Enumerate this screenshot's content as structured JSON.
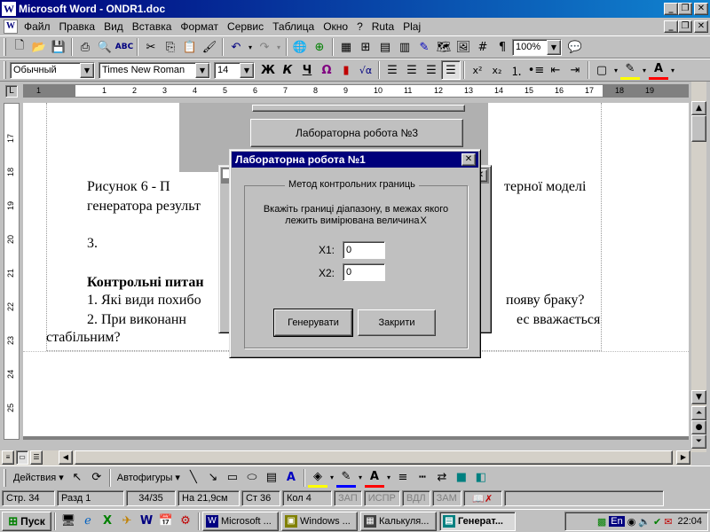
{
  "window": {
    "title": "Microsoft Word - ONDR1.doc",
    "app_icon": "W"
  },
  "menu": [
    "Файл",
    "Правка",
    "Вид",
    "Вставка",
    "Формат",
    "Сервис",
    "Таблица",
    "Окно",
    "?",
    "Ruta",
    "Plaj"
  ],
  "toolbar": {
    "zoom": "100%"
  },
  "format": {
    "style": "Обычный",
    "font": "Times New Roman",
    "size": "14",
    "bold": "Ж",
    "italic": "К",
    "underline": "Ч"
  },
  "ruler": {
    "ticks": [
      "1",
      "1",
      "2",
      "3",
      "4",
      "5",
      "6",
      "7",
      "8",
      "9",
      "10",
      "11",
      "12",
      "13",
      "14",
      "15",
      "16",
      "17",
      "18",
      "19"
    ]
  },
  "vruler": {
    "ticks": [
      "17",
      "18",
      "19",
      "20",
      "21",
      "22",
      "23",
      "24",
      "25"
    ]
  },
  "document": {
    "line1_left": "Рисунок 6 - П",
    "line1_right": "терної моделі",
    "line2": "генератора результ",
    "item3": "3.",
    "heading": "Контрольні питан",
    "q1_left": "1. Які види похибо",
    "q1_right": "появу браку?",
    "q2_left": "2. При виконанн",
    "q2_right": "ес вважається",
    "q2_line2": "стабільним?"
  },
  "background_dialog": {
    "button": "Лабораторна робота №3"
  },
  "dialog": {
    "title": "Лабораторна робота №1",
    "group": "Метод контрольних границь",
    "instruction_line1": "Вкажіть границі діапазону, в межах якого",
    "instruction_line2": "лежить вимірювана величина",
    "var_symbol": "X",
    "x1_label": "X1:",
    "x1_value": "0",
    "x2_label": "X2:",
    "x2_value": "0",
    "generate": "Генерувати",
    "close": "Закрити"
  },
  "drawbar": {
    "actions": "Действия",
    "autoshapes": "Автофигуры"
  },
  "status": {
    "page": "Стр. 34",
    "section": "Разд 1",
    "pages": "34/35",
    "at": "На 21,9см",
    "line": "Ст 36",
    "col": "Кол 4",
    "rec": "ЗАП",
    "trk": "ИСПР",
    "ext": "ВДЛ",
    "ovr": "ЗАМ"
  },
  "taskbar": {
    "start": "Пуск",
    "tasks": [
      "Microsoft ...",
      "Windows ...",
      "Калькуля...",
      "Генерат..."
    ],
    "lang": "En",
    "clock": "22:04"
  }
}
